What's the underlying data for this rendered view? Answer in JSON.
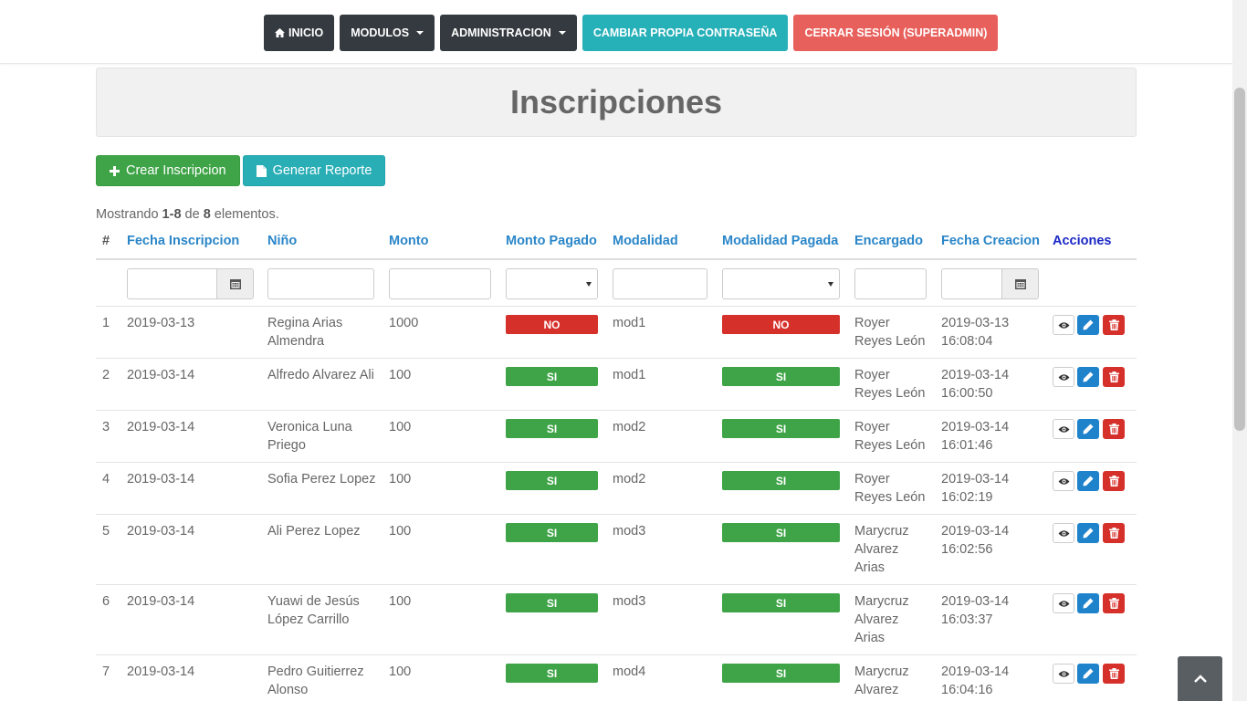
{
  "nav": {
    "inicio": "INICIO",
    "modulos": "MODULOS",
    "administracion": "ADMINISTRACION",
    "cambiar": "CAMBIAR PROPIA CONTRASEÑA",
    "cerrar": "CERRAR SESIÓN (SUPERADMIN)"
  },
  "page": {
    "title": "Inscripciones",
    "create_label": "Crear Inscripcion",
    "report_label": "Generar Reporte"
  },
  "summary": {
    "prefix": "Mostrando ",
    "range": "1-8",
    "of": " de ",
    "total": "8",
    "suffix": " elementos."
  },
  "table": {
    "headers": {
      "num": "#",
      "fecha": "Fecha Inscripcion",
      "nino": "Niño",
      "monto": "Monto",
      "pagado": "Monto Pagado",
      "modalidad": "Modalidad",
      "modalidad_pagada": "Modalidad Pagada",
      "encargado": "Encargado",
      "creacion": "Fecha Creacion",
      "acciones": "Acciones"
    },
    "rows": [
      {
        "num": "1",
        "fecha": "2019-03-13",
        "nino": "Regina Arias Almendra",
        "monto": "1000",
        "pagado": "NO",
        "modalidad": "mod1",
        "modalidad_pagada": "NO",
        "encargado": "Royer Reyes León",
        "creacion_date": "2019-03-13",
        "creacion_time": "16:08:04"
      },
      {
        "num": "2",
        "fecha": "2019-03-14",
        "nino": "Alfredo Alvarez Ali",
        "monto": "100",
        "pagado": "SI",
        "modalidad": "mod1",
        "modalidad_pagada": "SI",
        "encargado": "Royer Reyes León",
        "creacion_date": "2019-03-14",
        "creacion_time": "16:00:50"
      },
      {
        "num": "3",
        "fecha": "2019-03-14",
        "nino": "Veronica Luna Priego",
        "monto": "100",
        "pagado": "SI",
        "modalidad": "mod2",
        "modalidad_pagada": "SI",
        "encargado": "Royer Reyes León",
        "creacion_date": "2019-03-14",
        "creacion_time": "16:01:46"
      },
      {
        "num": "4",
        "fecha": "2019-03-14",
        "nino": "Sofia Perez Lopez",
        "monto": "100",
        "pagado": "SI",
        "modalidad": "mod2",
        "modalidad_pagada": "SI",
        "encargado": "Royer Reyes León",
        "creacion_date": "2019-03-14",
        "creacion_time": "16:02:19"
      },
      {
        "num": "5",
        "fecha": "2019-03-14",
        "nino": "Ali Perez Lopez",
        "monto": "100",
        "pagado": "SI",
        "modalidad": "mod3",
        "modalidad_pagada": "SI",
        "encargado": "Marycruz Alvarez Arias",
        "creacion_date": "2019-03-14",
        "creacion_time": "16:02:56"
      },
      {
        "num": "6",
        "fecha": "2019-03-14",
        "nino": "Yuawi de Jesús López Carrillo",
        "monto": "100",
        "pagado": "SI",
        "modalidad": "mod3",
        "modalidad_pagada": "SI",
        "encargado": "Marycruz Alvarez Arias",
        "creacion_date": "2019-03-14",
        "creacion_time": "16:03:37"
      },
      {
        "num": "7",
        "fecha": "2019-03-14",
        "nino": "Pedro Guitierrez Alonso",
        "monto": "100",
        "pagado": "SI",
        "modalidad": "mod4",
        "modalidad_pagada": "SI",
        "encargado": "Marycruz Alvarez",
        "creacion_date": "2019-03-14",
        "creacion_time": "16:04:16"
      }
    ]
  },
  "colors": {
    "nav_dark": "#343a40",
    "teal": "#26b0b8",
    "red": "#e8605c",
    "green": "#3fa447",
    "badge_red": "#d6302b",
    "link_blue": "#2a86c8"
  },
  "icons": {
    "home": "home-icon",
    "plus": "plus-icon",
    "file": "file-icon",
    "calendar": "calendar-icon",
    "view": "eye-icon",
    "edit": "pencil-icon",
    "delete": "trash-icon",
    "to_top": "chevron-up-icon"
  }
}
